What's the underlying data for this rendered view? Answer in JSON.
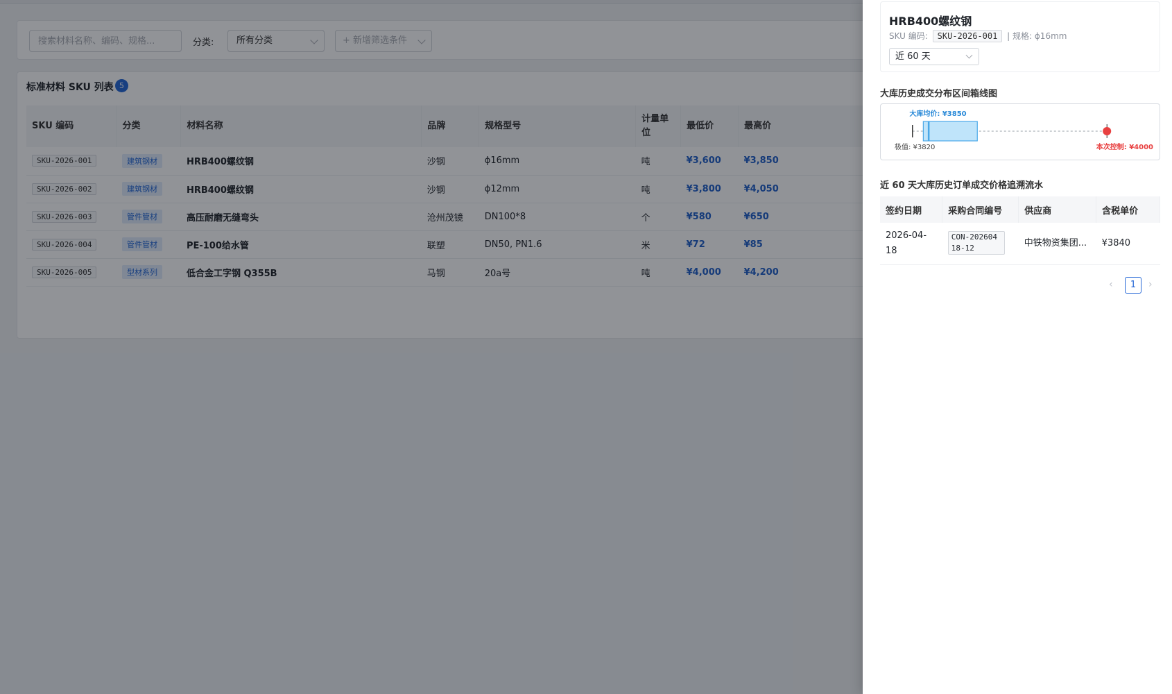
{
  "filters": {
    "search_placeholder": "搜索材料名称、编码、规格...",
    "category_label": "分类:",
    "category_value": "所有分类",
    "add_filter": "+ 新增筛选条件"
  },
  "list": {
    "title": "标准材料 SKU 列表",
    "count": "5",
    "columns": [
      "SKU 编码",
      "分类",
      "材料名称",
      "品牌",
      "规格型号",
      "计量单位",
      "最低价",
      "最高价"
    ],
    "rows": [
      {
        "code": "SKU-2026-001",
        "category": "建筑钢材",
        "name": "HRB400螺纹钢",
        "brand": "沙钢",
        "spec": "ϕ16mm",
        "unit": "吨",
        "min": "¥3,600",
        "max": "¥3,850"
      },
      {
        "code": "SKU-2026-002",
        "category": "建筑钢材",
        "name": "HRB400螺纹钢",
        "brand": "沙钢",
        "spec": "ϕ12mm",
        "unit": "吨",
        "min": "¥3,800",
        "max": "¥4,050"
      },
      {
        "code": "SKU-2026-003",
        "category": "管件管材",
        "name": "高压耐磨无缝弯头",
        "brand": "沧州茂镜",
        "spec": "DN100*8",
        "unit": "个",
        "min": "¥580",
        "max": "¥650"
      },
      {
        "code": "SKU-2026-004",
        "category": "管件管材",
        "name": "PE-100给水管",
        "brand": "联塑",
        "spec": "DN50, PN1.6",
        "unit": "米",
        "min": "¥72",
        "max": "¥85"
      },
      {
        "code": "SKU-2026-005",
        "category": "型材系列",
        "name": "低合金工字钢 Q355B",
        "brand": "马钢",
        "spec": "20a号",
        "unit": "吨",
        "min": "¥4,000",
        "max": "¥4,200"
      }
    ]
  },
  "drawer": {
    "title": "HRB400螺纹钢",
    "sku_label": "SKU 编码:",
    "sku_code": "SKU-2026-001",
    "spec_text": "| 规格: ϕ16mm",
    "range_value": "近 60 天",
    "box_title": "大库历史成交分布区间箱线图",
    "box": {
      "avg_label": "大库均价: ¥3850",
      "min_label": "极值: ¥3820",
      "control_label": "本次控制: ¥4000",
      "whisker_min": 3820,
      "q1": 3830,
      "median": 3835,
      "q3": 3880,
      "control": 4000,
      "axis_min": 3815,
      "axis_max": 4005,
      "box_color": "#bfe4fa",
      "box_stroke": "#4aa8e8",
      "control_color": "#e84040"
    },
    "history_title": "近 60 天大库历史订单成交价格追溯流水",
    "history_columns": [
      "签约日期",
      "采购合同编号",
      "供应商",
      "含税单价"
    ],
    "history_rows": [
      {
        "date": "2026-04-18",
        "contract": "CON-20260418-12",
        "supplier": "中铁物资集团...",
        "price": "¥3840"
      }
    ],
    "page": "1"
  }
}
